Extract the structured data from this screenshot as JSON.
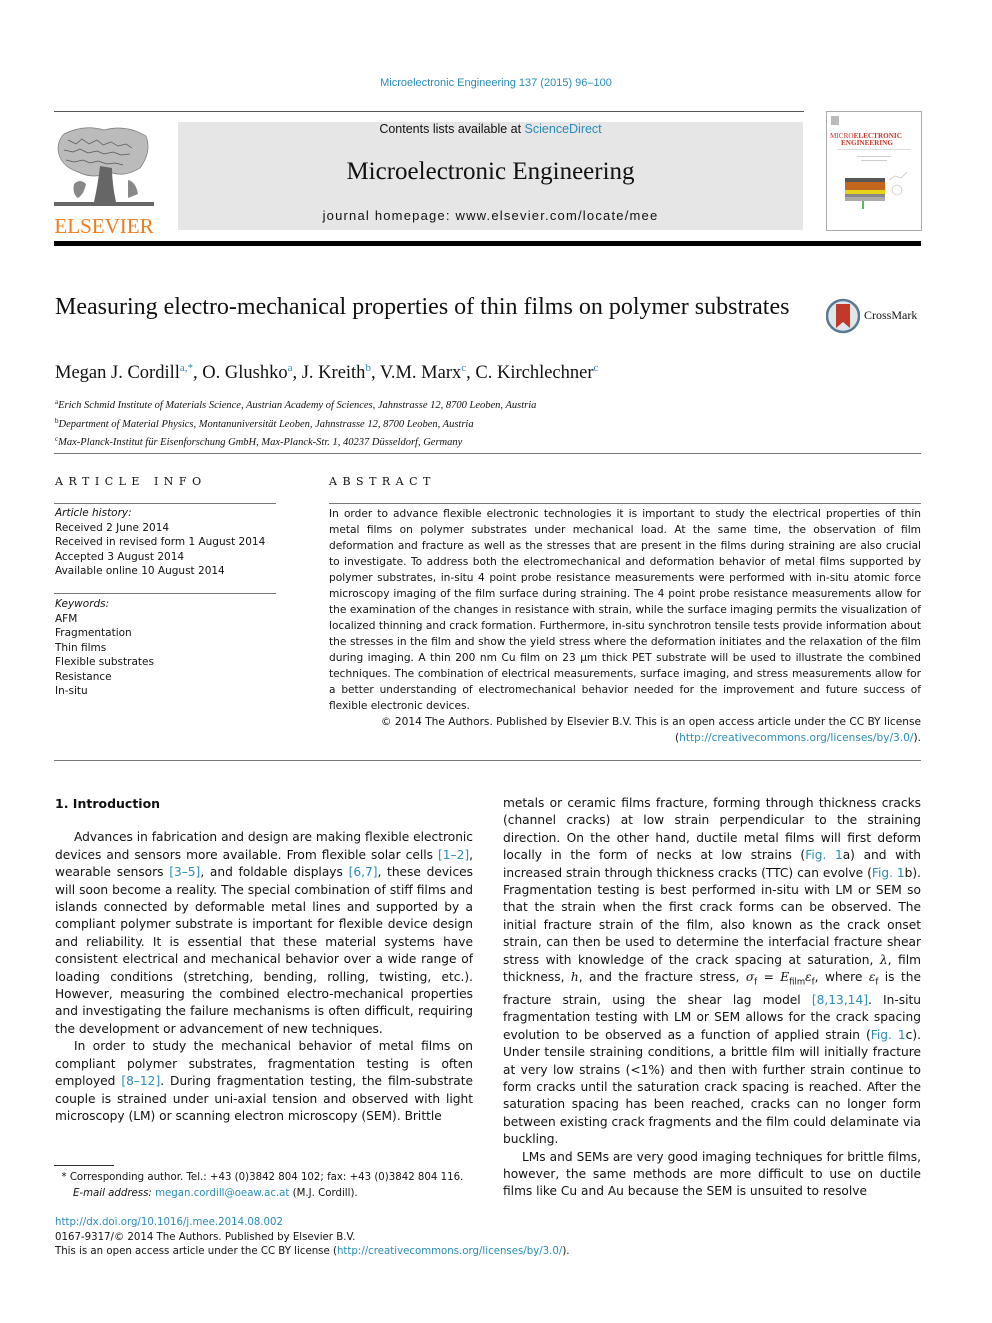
{
  "header": {
    "citation": "Microelectronic Engineering 137 (2015) 96–100",
    "contents_prefix": "Contents lists available at ",
    "contents_link": "ScienceDirect",
    "journal_name": "Microelectronic Engineering",
    "homepage_prefix": "journal homepage: ",
    "homepage_url": "www.elsevier.com/locate/mee",
    "publisher_logo_text": "ELSEVIER",
    "cover_title_1": "MICRO",
    "cover_title_2": "ELECTRONIC",
    "cover_title_3": "ENGINEERING",
    "crossmark_label": "CrossMark"
  },
  "article": {
    "title": "Measuring electro-mechanical properties of thin films on polymer substrates",
    "authors": [
      {
        "name": "Megan J. Cordill",
        "marks": "a,*",
        "sep": ", "
      },
      {
        "name": "O. Glushko",
        "marks": "a",
        "sep": ", "
      },
      {
        "name": "J. Kreith",
        "marks": "b",
        "sep": ", "
      },
      {
        "name": "V.M. Marx",
        "marks": "c",
        "sep": ", "
      },
      {
        "name": "C. Kirchlechner",
        "marks": "c",
        "sep": ""
      }
    ],
    "affiliations": [
      {
        "mark": "a",
        "text": "Erich Schmid Institute of Materials Science, Austrian Academy of Sciences, Jahnstrasse 12, 8700 Leoben, Austria"
      },
      {
        "mark": "b",
        "text": "Department of Material Physics, Montanuniversität Leoben, Jahnstrasse 12, 8700 Leoben, Austria"
      },
      {
        "mark": "c",
        "text": "Max-Planck-Institut für Eisenforschung GmbH, Max-Planck-Str. 1, 40237 Düsseldorf, Germany"
      }
    ]
  },
  "article_info": {
    "heading": "ARTICLE INFO",
    "history_label": "Article history:",
    "history": [
      "Received 2 June 2014",
      "Received in revised form 1 August 2014",
      "Accepted 3 August 2014",
      "Available online 10 August 2014"
    ],
    "keywords_label": "Keywords:",
    "keywords": [
      "AFM",
      "Fragmentation",
      "Thin films",
      "Flexible substrates",
      "Resistance",
      "In-situ"
    ]
  },
  "abstract": {
    "heading": "ABSTRACT",
    "text": "In order to advance flexible electronic technologies it is important to study the electrical properties of thin metal films on polymer substrates under mechanical load. At the same time, the observation of film deformation and fracture as well as the stresses that are present in the films during straining are also crucial to investigate. To address both the electromechanical and deformation behavior of metal films supported by polymer substrates, in-situ 4 point probe resistance measurements were performed with in-situ atomic force microscopy imaging of the film surface during straining. The 4 point probe resistance measurements allow for the examination of the changes in resistance with strain, while the surface imaging permits the visualization of localized thinning and crack formation. Furthermore, in-situ synchrotron tensile tests provide information about the stresses in the film and show the yield stress where the deformation initiates and the relaxation of the film during imaging. A thin 200 nm Cu film on 23 µm thick PET substrate will be used to illustrate the combined techniques. The combination of electrical measurements, surface imaging, and stress measurements allow for a better understanding of electromechanical behavior needed for the improvement and future success of flexible electronic devices.",
    "copyright": "© 2014 The Authors. Published by Elsevier B.V. This is an open access article under the CC BY license",
    "license_open": "(",
    "license_url": "http://creativecommons.org/licenses/by/3.0/",
    "license_close": ")."
  },
  "body": {
    "section_heading": "1. Introduction",
    "left": {
      "p1_a": "Advances in fabrication and design are making flexible electronic devices and sensors more available. From flexible solar cells ",
      "ref1": "[1–2]",
      "p1_b": ", wearable sensors ",
      "ref2": "[3–5]",
      "p1_c": ", and foldable displays ",
      "ref3": "[6,7]",
      "p1_d": ", these devices will soon become a reality. The special combination of stiff films and islands connected by deformable metal lines and supported by a compliant polymer substrate is important for flexible device design and reliability. It is essential that these material systems have consistent electrical and mechanical behavior over a wide range of loading conditions (stretching, bending, rolling, twisting, etc.). However, measuring the combined electro-mechanical properties and investigating the failure mechanisms is often difficult, requiring the development or advancement of new techniques.",
      "p2_a": "In order to study the mechanical behavior of metal films on compliant polymer substrates, fragmentation testing is often employed ",
      "ref4": "[8–12]",
      "p2_b": ". During fragmentation testing, the film-substrate couple is strained under uni-axial tension and observed with light microscopy (LM) or scanning electron microscopy (SEM). Brittle"
    },
    "right": {
      "p1_a": "metals or ceramic films fracture, forming through thickness cracks (channel cracks) at low strain perpendicular to the straining direction. On the other hand, ductile metal films will first deform locally in the form of necks at low strains (",
      "fig1": "Fig. 1",
      "p1_b": "a) and with increased strain through thickness cracks (TTC) can evolve (",
      "fig2": "Fig. 1",
      "p1_c": "b). Fragmentation testing is best performed in-situ with LM or SEM so that the strain when the first crack forms can be observed. The initial fracture strain of the film, also known as the crack onset strain, can then be used to determine the interfacial fracture shear stress with knowledge of the crack spacing at saturation, ",
      "lambda": "λ",
      "p1_d": ", film thickness, ",
      "h": "h",
      "p1_e": ", and the fracture stress, ",
      "sigma": "σ",
      "sub_f": "f",
      "eq": " = ",
      "E": "E",
      "sub_film": "film",
      "eps": "ε",
      "p1_f": ", where ",
      "p1_g": " is the fracture strain, using the shear lag model ",
      "ref5": "[8,13,14]",
      "p1_h": ". In-situ fragmentation testing with LM or SEM allows for the crack spacing evolution to be observed as a function of applied strain (",
      "fig3": "Fig. 1",
      "p1_i": "c). Under tensile straining conditions, a brittle film will initially fracture at very low strains (<1%) and then with further strain continue to form cracks until the saturation crack spacing is reached. After the saturation spacing has been reached, cracks can no longer form between existing crack fragments and the film could delaminate via buckling.",
      "p2": "LMs and SEMs are very good imaging techniques for brittle films, however, the same methods are more difficult to use on ductile films like Cu and Au because the SEM is unsuited to resolve"
    }
  },
  "footnote": {
    "star": "*",
    "corresponding": " Corresponding author. Tel.: +43 (0)3842 804 102; fax: +43 (0)3842 804 116.",
    "email_label": "E-mail address:",
    "email": "megan.cordill@oeaw.ac.at",
    "email_suffix": " (M.J. Cordill)."
  },
  "bottom": {
    "doi": "http://dx.doi.org/10.1016/j.mee.2014.08.002",
    "issn": "0167-9317/© 2014 The Authors. Published by Elsevier B.V.",
    "oa_prefix": "This is an open access article under the CC BY license (",
    "oa_url": "http://creativecommons.org/licenses/by/3.0/",
    "oa_suffix": ")."
  },
  "colors": {
    "link": "#2a8cb7",
    "elsevier_orange": "#f07c1b",
    "masthead_bg": "#e6e6e6"
  }
}
